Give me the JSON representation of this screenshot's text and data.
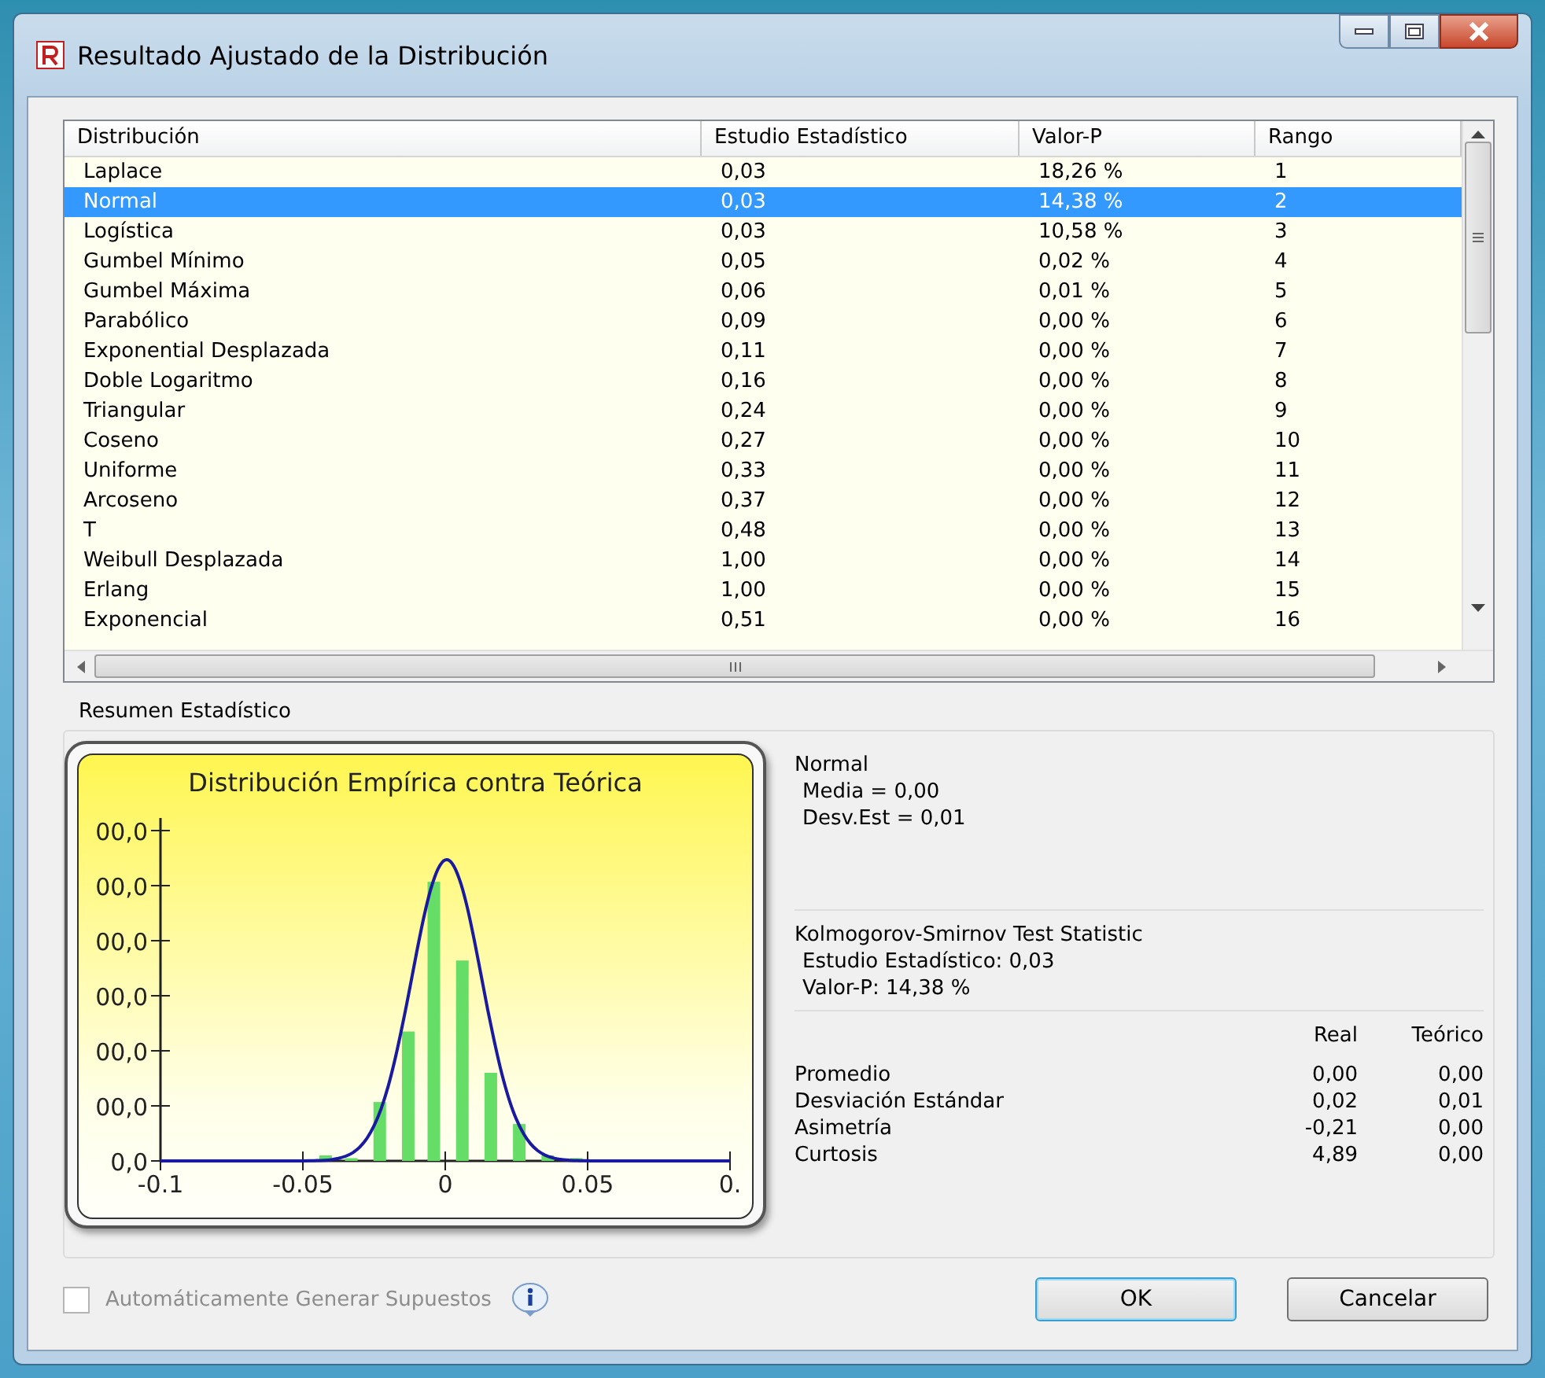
{
  "window": {
    "title": "Resultado Ajustado de la Distribución"
  },
  "table": {
    "columns": [
      "Distribución",
      "Estudio Estadístico",
      "Valor-P",
      "Rango"
    ],
    "rows": [
      {
        "cells": [
          "Laplace",
          "0,03",
          "18,26 %",
          "1"
        ],
        "selected": false
      },
      {
        "cells": [
          "Normal",
          "0,03",
          "14,38 %",
          "2"
        ],
        "selected": true
      },
      {
        "cells": [
          "Logística",
          "0,03",
          "10,58 %",
          "3"
        ],
        "selected": false
      },
      {
        "cells": [
          "Gumbel Mínimo",
          "0,05",
          "0,02 %",
          "4"
        ],
        "selected": false
      },
      {
        "cells": [
          "Gumbel Máxima",
          "0,06",
          "0,01 %",
          "5"
        ],
        "selected": false
      },
      {
        "cells": [
          "Parabólico",
          "0,09",
          "0,00 %",
          "6"
        ],
        "selected": false
      },
      {
        "cells": [
          "Exponential Desplazada",
          "0,11",
          "0,00 %",
          "7"
        ],
        "selected": false
      },
      {
        "cells": [
          "Doble Logaritmo",
          "0,16",
          "0,00 %",
          "8"
        ],
        "selected": false
      },
      {
        "cells": [
          "Triangular",
          "0,24",
          "0,00 %",
          "9"
        ],
        "selected": false
      },
      {
        "cells": [
          "Coseno",
          "0,27",
          "0,00 %",
          "10"
        ],
        "selected": false
      },
      {
        "cells": [
          "Uniforme",
          "0,33",
          "0,00 %",
          "11"
        ],
        "selected": false
      },
      {
        "cells": [
          "Arcoseno",
          "0,37",
          "0,00 %",
          "12"
        ],
        "selected": false
      },
      {
        "cells": [
          "T",
          "0,48",
          "0,00 %",
          "13"
        ],
        "selected": false
      },
      {
        "cells": [
          "Weibull Desplazada",
          "1,00",
          "0,00 %",
          "14"
        ],
        "selected": false
      },
      {
        "cells": [
          "Erlang",
          "1,00",
          "0,00 %",
          "15"
        ],
        "selected": false
      },
      {
        "cells": [
          "Exponencial",
          "0,51",
          "0,00 %",
          "16"
        ],
        "selected": false
      }
    ]
  },
  "summary": {
    "title": "Resumen Estadístico",
    "chart": {
      "title": "Distribución Empírica contra Teórica",
      "x_tick_labels": [
        "-0.1",
        "-0.05",
        "0",
        "0.05",
        "0."
      ],
      "y_tick_labels": [
        "00,0",
        "00,0",
        "00,0",
        "00,0",
        "00,0",
        "00,0",
        "0,0"
      ]
    },
    "fit": {
      "name": "Normal",
      "params": [
        "Media = 0,00",
        "Desv.Est = 0,01"
      ]
    },
    "test": {
      "title": "Kolmogorov-Smirnov Test Statistic",
      "lines": [
        "Estudio Estadístico: 0,03",
        "Valor-P: 14,38 %"
      ]
    },
    "stats": {
      "columns": [
        "Real",
        "Teórico"
      ],
      "rows": [
        {
          "label": "Promedio",
          "values": [
            "0,00",
            "0,00"
          ]
        },
        {
          "label": "Desviación Estándar",
          "values": [
            "0,02",
            "0,01"
          ]
        },
        {
          "label": "Asimetría",
          "values": [
            "-0,21",
            "0,00"
          ]
        },
        {
          "label": "Curtosis",
          "values": [
            "4,89",
            "0,00"
          ]
        }
      ]
    }
  },
  "auto_generate": {
    "label": "Automáticamente Generar Supuestos",
    "checked": false,
    "disabled": true
  },
  "buttons": [
    {
      "label": "OK",
      "default": true
    },
    {
      "label": "Cancelar",
      "default": false
    }
  ]
}
